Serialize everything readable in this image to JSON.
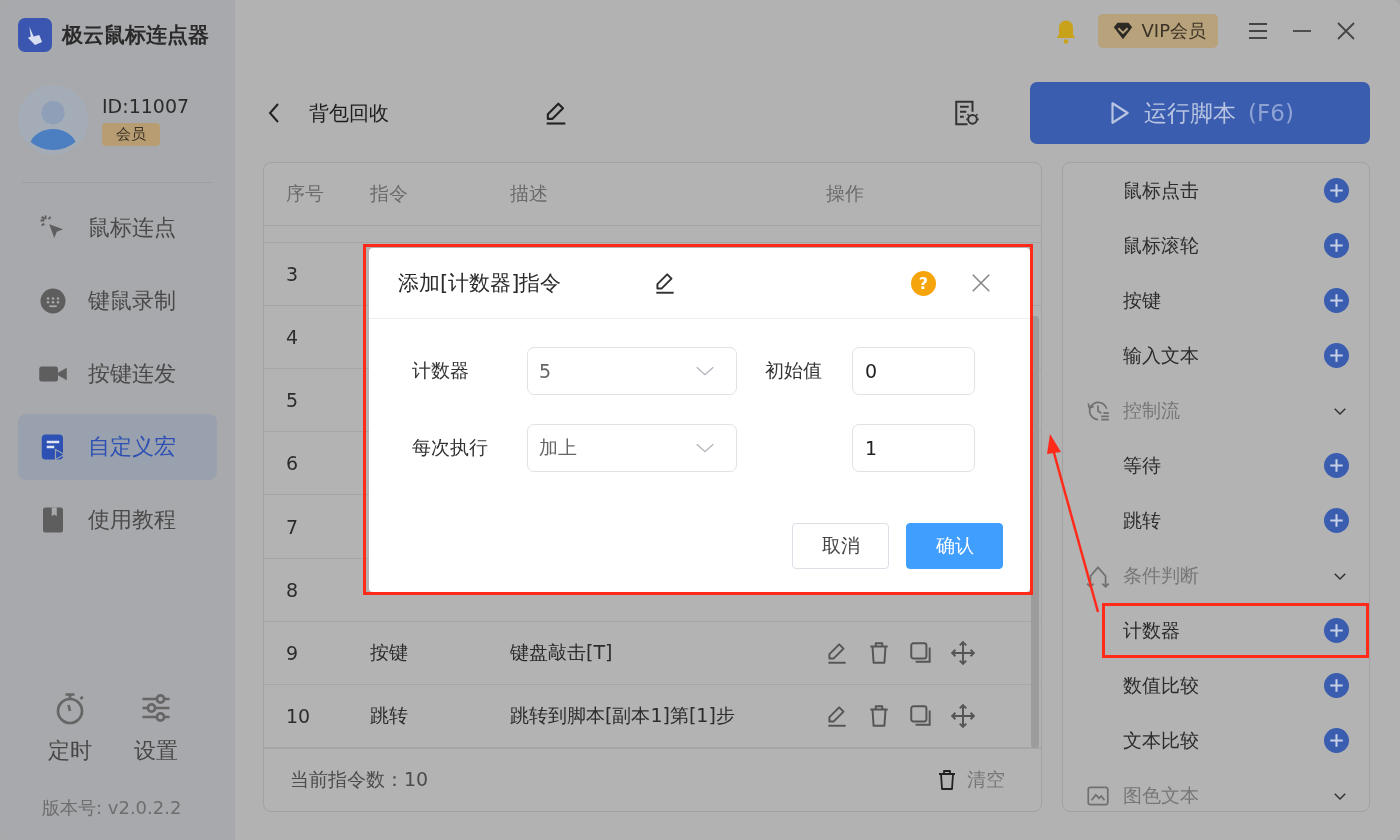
{
  "app": {
    "title": "极云鼠标连点器"
  },
  "user": {
    "id": "ID:11007",
    "badge": "会员"
  },
  "nav": [
    {
      "label": "鼠标连点",
      "selected": false
    },
    {
      "label": "键鼠录制",
      "selected": false
    },
    {
      "label": "按键连发",
      "selected": false
    },
    {
      "label": "自定义宏",
      "selected": true
    },
    {
      "label": "使用教程",
      "selected": false
    }
  ],
  "tools": [
    {
      "label": "定时"
    },
    {
      "label": "设置"
    }
  ],
  "version": "版本号: v2.0.2.2",
  "top_bar": {
    "vip": "VIP会员"
  },
  "script": {
    "title": "背包回收"
  },
  "run_button": {
    "label": "运行脚本",
    "shortcut": "(F6)"
  },
  "table": {
    "columns": [
      "序号",
      "指令",
      "描述",
      "操作"
    ],
    "rows": [
      {
        "index": "3"
      },
      {
        "index": "4"
      },
      {
        "index": "5"
      },
      {
        "index": "6"
      },
      {
        "index": "7"
      },
      {
        "index": "8"
      },
      {
        "index": "9",
        "command": "按键",
        "description": "键盘敲击[T]"
      },
      {
        "index": "10",
        "command": "跳转",
        "description": "跳转到脚本[副本1]第[1]步"
      }
    ],
    "footer": "当前指令数：10",
    "clear": "清空"
  },
  "commands": [
    {
      "kind": "command",
      "label": "鼠标点击",
      "annotated": false
    },
    {
      "kind": "command",
      "label": "鼠标滚轮",
      "annotated": false
    },
    {
      "kind": "command",
      "label": "按键",
      "annotated": false
    },
    {
      "kind": "command",
      "label": "输入文本",
      "annotated": false
    },
    {
      "kind": "group",
      "label": "控制流",
      "annotated": false
    },
    {
      "kind": "command",
      "label": "等待",
      "annotated": false
    },
    {
      "kind": "command",
      "label": "跳转",
      "annotated": false
    },
    {
      "kind": "group",
      "label": "条件判断",
      "annotated": false
    },
    {
      "kind": "command",
      "label": "计数器",
      "annotated": true
    },
    {
      "kind": "command",
      "label": "数值比较",
      "annotated": false
    },
    {
      "kind": "command",
      "label": "文本比较",
      "annotated": false
    },
    {
      "kind": "group",
      "label": "图色文本",
      "annotated": false
    }
  ],
  "dialog": {
    "title": "添加[计数器]指令",
    "help": "?",
    "annotated": true,
    "fields": [
      {
        "kind": "select",
        "label": "计数器",
        "value": "5"
      },
      {
        "kind": "input",
        "label": "初始值",
        "value": "0"
      },
      {
        "kind": "select",
        "label": "每次执行",
        "value": "加上"
      },
      {
        "kind": "input",
        "value": "1"
      }
    ],
    "buttons": [
      {
        "label": "取消",
        "primary": false
      },
      {
        "label": "确认",
        "primary": true
      }
    ]
  }
}
